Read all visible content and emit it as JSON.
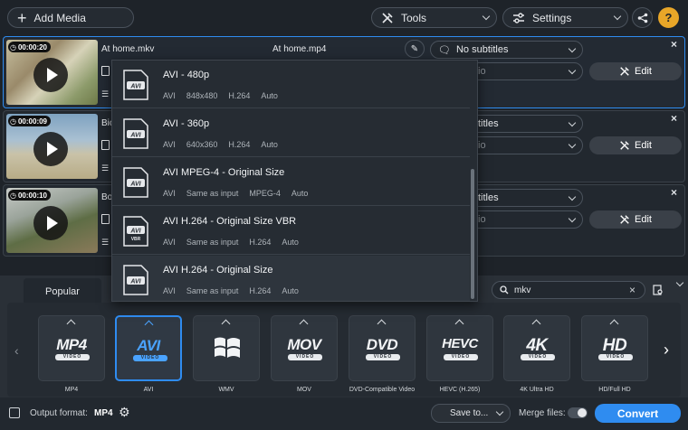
{
  "toolbar": {
    "add_media": "Add Media",
    "tools": "Tools",
    "settings": "Settings",
    "help": "?"
  },
  "files": [
    {
      "duration": "00:00:20",
      "name": "At home.mkv",
      "output": "At home.mp4",
      "subtitles": "No subtitles",
      "audio": "io",
      "edit": "Edit"
    },
    {
      "duration": "00:00:09",
      "name": "Bic",
      "subtitles": "titles",
      "audio": "io",
      "edit": "Edit"
    },
    {
      "duration": "00:00:10",
      "name": "Boa",
      "subtitles": "titles",
      "audio": "io",
      "edit": "Edit"
    }
  ],
  "presets": [
    {
      "title": "AVI - 480p",
      "format": "AVI",
      "size": "848x480",
      "codec": "H.264",
      "audio": "Auto"
    },
    {
      "title": "AVI - 360p",
      "format": "AVI",
      "size": "640x360",
      "codec": "H.264",
      "audio": "Auto"
    },
    {
      "title": "AVI MPEG-4 - Original Size",
      "format": "AVI",
      "size": "Same as input",
      "codec": "MPEG-4",
      "audio": "Auto"
    },
    {
      "title": "AVI H.264 - Original Size VBR",
      "format": "AVI",
      "size": "Same as input",
      "codec": "H.264",
      "audio": "Auto"
    },
    {
      "title": "AVI H.264 - Original Size",
      "format": "AVI",
      "size": "Same as input",
      "codec": "H.264",
      "audio": "Auto"
    }
  ],
  "icon_labels": {
    "avi": "AVI",
    "vbr": "VBR",
    "video": "VIDEO"
  },
  "tabs": {
    "popular": "Popular"
  },
  "search": {
    "value": "mkv"
  },
  "formats": [
    {
      "logo": "MP4",
      "caption": "MP4"
    },
    {
      "logo": "AVI",
      "caption": "AVI"
    },
    {
      "logo": "",
      "caption": "WMV"
    },
    {
      "logo": "MOV",
      "caption": "MOV"
    },
    {
      "logo": "DVD",
      "caption": "DVD-Compatible Video"
    },
    {
      "logo": "HEVC",
      "caption": "HEVC (H.265)"
    },
    {
      "logo": "4K",
      "caption": "4K Ultra HD"
    },
    {
      "logo": "HD",
      "caption": "HD/Full HD"
    }
  ],
  "footer": {
    "output_label": "Output format:",
    "output_value": "MP4",
    "save_to": "Save to...",
    "merge": "Merge files:",
    "convert": "Convert"
  },
  "colors": {
    "accent": "#2f8cf0",
    "convert": "#2f8cf0"
  }
}
